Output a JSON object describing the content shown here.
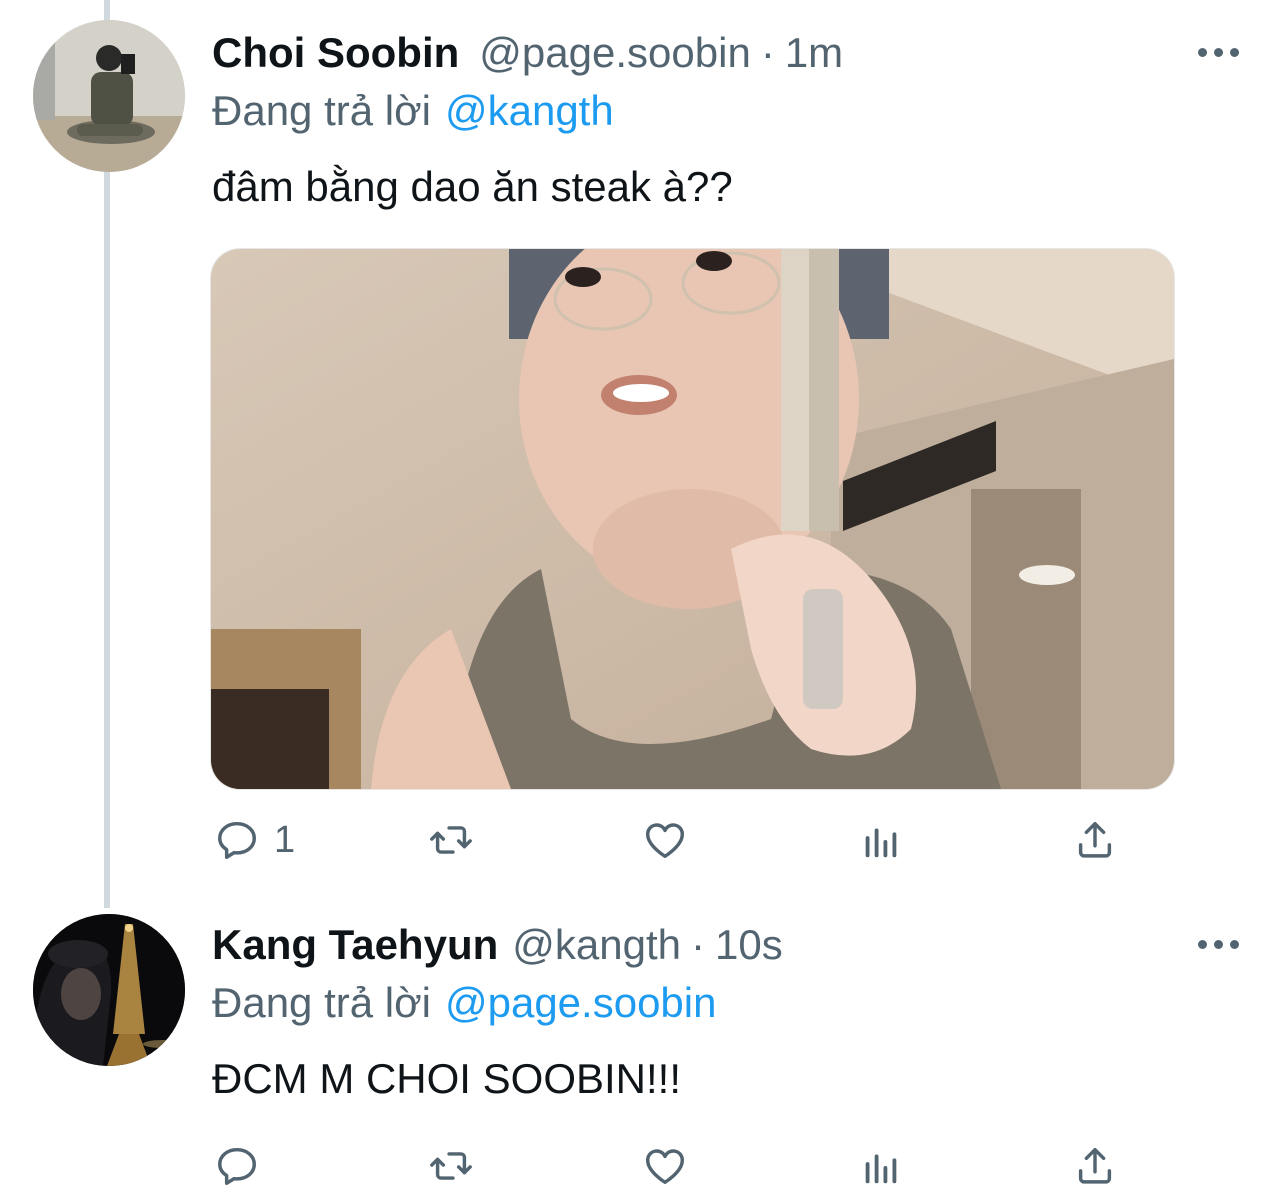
{
  "tweets": [
    {
      "author_name": "Choi Soobin",
      "handle": "@page.soobin",
      "separator": "·",
      "time": "1m",
      "reply_prefix": "Đang trả lời",
      "reply_to": "@kangth",
      "text": "đâm bằng dao ăn steak à??",
      "reply_count": "1",
      "has_media": true
    },
    {
      "author_name": "Kang Taehyun",
      "handle": "@kangth",
      "separator": "·",
      "time": "10s",
      "reply_prefix": "Đang trả lời",
      "reply_to": "@page.soobin",
      "text": "ĐCM M CHOI SOOBIN!!!",
      "reply_count": "",
      "has_media": false
    }
  ],
  "icons": [
    "reply-icon",
    "retweet-icon",
    "like-icon",
    "views-icon",
    "share-icon",
    "more-icon"
  ],
  "colors": {
    "link": "#1d9bf0",
    "secondary_text": "#536471",
    "thread_line": "#cfd9de"
  }
}
